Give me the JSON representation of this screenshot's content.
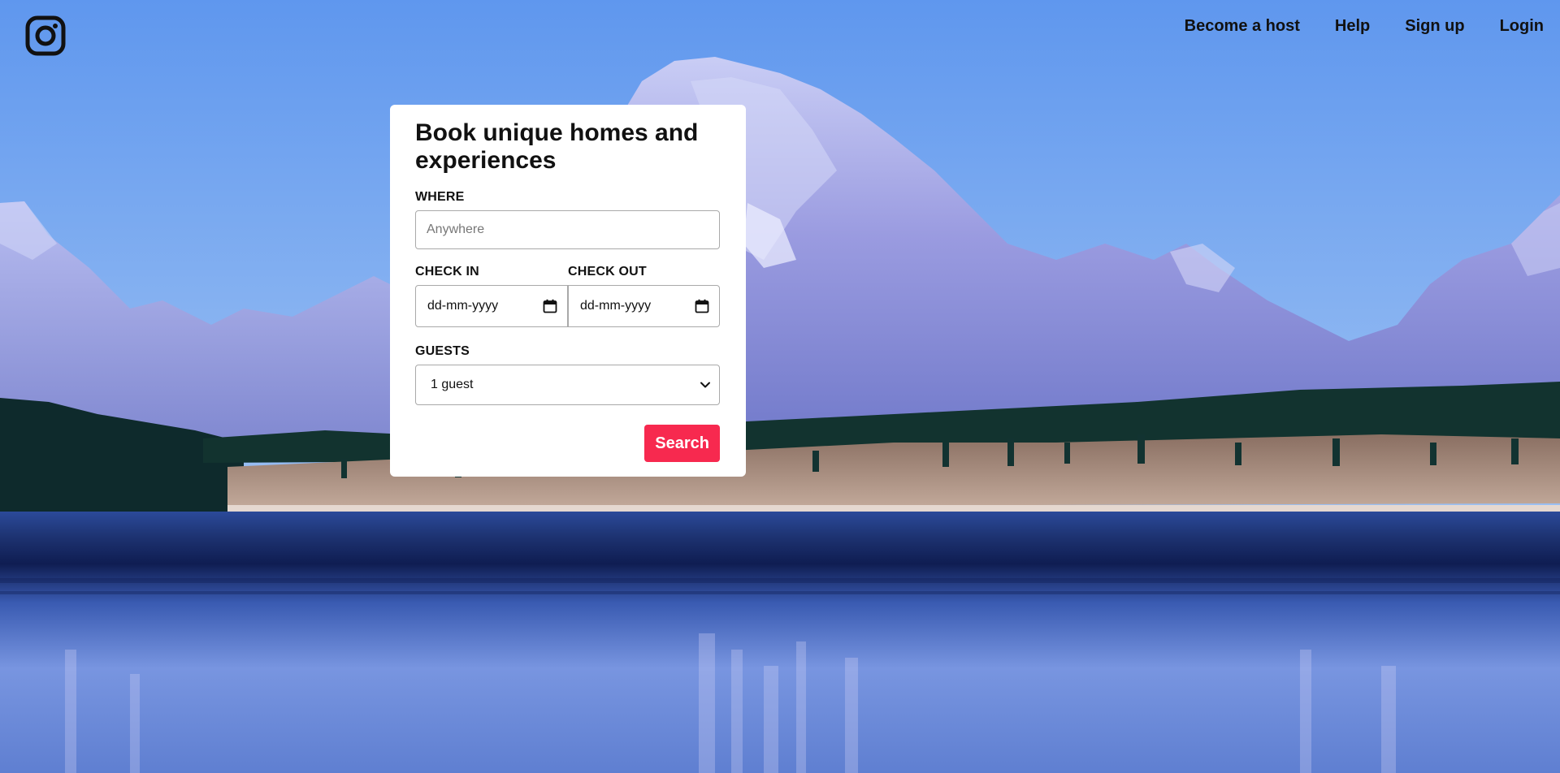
{
  "nav": {
    "logo_icon": "instagram-icon",
    "items": [
      {
        "label": "Become a host"
      },
      {
        "label": "Help"
      },
      {
        "label": "Sign up"
      },
      {
        "label": "Login"
      }
    ]
  },
  "booking": {
    "title": "Book unique homes and experiences",
    "where": {
      "label": "WHERE",
      "placeholder": "Anywhere",
      "value": ""
    },
    "check_in": {
      "label": "CHECK IN",
      "value": "dd-mm-yyyy",
      "icon": "calendar-icon"
    },
    "check_out": {
      "label": "CHECK OUT",
      "value": "dd-mm-yyyy",
      "icon": "calendar-icon"
    },
    "guests": {
      "label": "GUESTS",
      "selected": "1 guest",
      "icon": "chevron-down-icon"
    },
    "search_label": "Search"
  },
  "colors": {
    "accent": "#f7294f",
    "card_bg": "#ffffff",
    "nav_text": "#111111"
  }
}
